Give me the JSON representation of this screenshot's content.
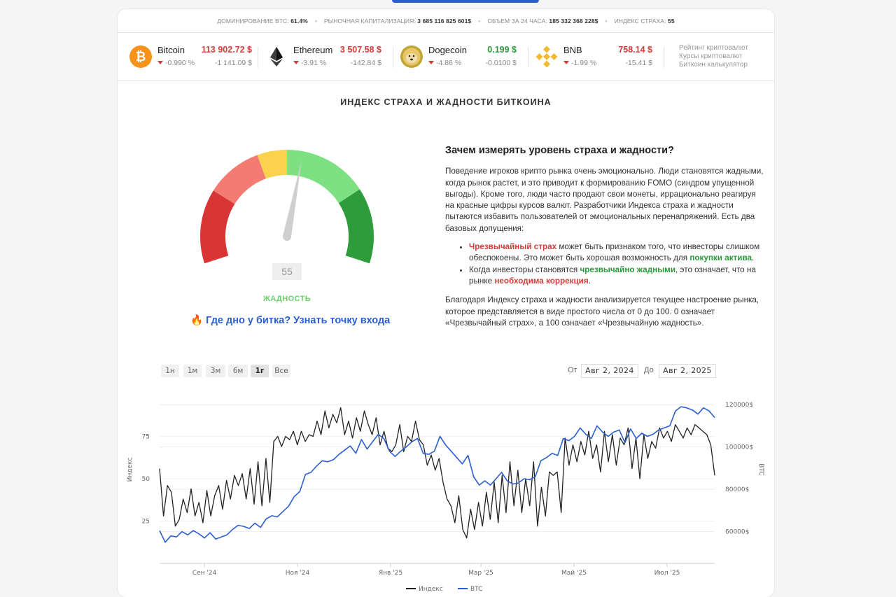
{
  "stats": [
    {
      "label": "ДОМИНИРОВАНИЕ BTC:",
      "value": "61.4%"
    },
    {
      "label": "РЫНОЧНАЯ КАПИТАЛИЗАЦИЯ:",
      "value": "3 685 116 825 601$"
    },
    {
      "label": "ОБЪЕМ ЗА 24 ЧАСА:",
      "value": "185 332 368 228$"
    },
    {
      "label": "ИНДЕКС СТРАХА:",
      "value": "55"
    }
  ],
  "coins": [
    {
      "name": "Bitcoin",
      "price": "113 902.72 $",
      "change_pct": "-0.990 %",
      "change_abs": "-1 141.09 $",
      "price_color": "#d23d3a",
      "icon": "bitcoin-icon"
    },
    {
      "name": "Ethereum",
      "price": "3 507.58 $",
      "change_pct": "-3.91 %",
      "change_abs": "-142.84 $",
      "price_color": "#d23d3a",
      "icon": "ethereum-icon"
    },
    {
      "name": "Dogecoin",
      "price": "0.199 $",
      "change_pct": "-4.86 %",
      "change_abs": "-0.0100 $",
      "price_color": "#2a9a3a",
      "icon": "dogecoin-icon"
    },
    {
      "name": "BNB",
      "price": "758.14 $",
      "change_pct": "-1.99 %",
      "change_abs": "-15.41 $",
      "price_color": "#d23d3a",
      "icon": "bnb-icon"
    }
  ],
  "side_links": [
    "Рейтинг криптовалют",
    "Курсы криптовалют",
    "Биткоин калькулятор"
  ],
  "section_title": "ИНДЕКС СТРАХА И ЖАДНОСТИ БИТКОИНА",
  "gauge": {
    "value": "55",
    "label": "ЖАДНОСТЬ",
    "level": 55
  },
  "cta": {
    "icon": "🔥",
    "text": "Где дно у битка? Узнать точку входа"
  },
  "article": {
    "heading": "Зачем измерять уровень страха и жадности?",
    "p1": "Поведение игроков крипто рынка очень эмоционально. Люди становятся жадными, когда рынок растет, и это приводит к формированию FOMO (синдром упущенной выгоды). Кроме того, люди часто продают свои монеты, иррационально реагируя на красные цифры курсов валют. Разработчики Индекса страха и жадности пытаются избавить пользователей от эмоциональных перенапряжений. Есть два базовых допущения:",
    "b1_kw": "Чрезвычайный страх",
    "b1_mid": " может быть признаком того, что инвесторы слишком обеспокоены. Это может быть хорошая возможность для ",
    "b1_kw2": "покупки актива",
    "b1_end": ".",
    "b2_start": "Когда инвесторы становятся ",
    "b2_kw": "чрезвычайно жадными",
    "b2_mid": ", это означает, что на рынке ",
    "b2_kw2": "необходима коррекция",
    "b2_end": ".",
    "p2": "Благодаря Индексу страха и жадности анализируется текущее настроение рынка, которое представляется в виде простого числа от 0 до 100. 0 означает «Чрезвычайный страх», а 100 означает «Чрезвычайную жадность»."
  },
  "range": {
    "buttons": [
      "1н",
      "1м",
      "3м",
      "6м",
      "1г",
      "Все"
    ],
    "active": "1г",
    "from_label": "От",
    "from": "Авг 2, 2024",
    "to_label": "До",
    "to": "Авг 2, 2025"
  },
  "chart_data": {
    "type": "line",
    "xlabel": "",
    "ylabel_left": "Индекс",
    "ylabel_right": "BTC",
    "x_ticks": [
      "Сен '24",
      "Ноя '24",
      "Янв '25",
      "Мар '25",
      "Май '25",
      "Июл '25"
    ],
    "y_left_ticks": [
      25,
      50,
      75
    ],
    "y_right_ticks": [
      "60000$",
      "80000$",
      "100000$",
      "120000$"
    ],
    "y_left_range": [
      0,
      100
    ],
    "y_right_range": [
      45000,
      125000
    ],
    "series": [
      {
        "name": "Индекс",
        "color": "#222222",
        "values": [
          56,
          28,
          46,
          42,
          22,
          26,
          38,
          30,
          44,
          28,
          36,
          24,
          43,
          28,
          40,
          46,
          32,
          49,
          38,
          52,
          46,
          53,
          38,
          56,
          35,
          60,
          34,
          62,
          36,
          72,
          75,
          69,
          75,
          73,
          78,
          70,
          78,
          72,
          76,
          75,
          84,
          76,
          90,
          80,
          88,
          83,
          92,
          76,
          84,
          74,
          86,
          78,
          90,
          82,
          76,
          86,
          70,
          78,
          68,
          66,
          70,
          82,
          66,
          75,
          72,
          84,
          73,
          70,
          58,
          64,
          55,
          62,
          48,
          38,
          34,
          24,
          40,
          20,
          15,
          32,
          20,
          36,
          22,
          42,
          26,
          48,
          24,
          52,
          30,
          60,
          34,
          55,
          30,
          50,
          34,
          60,
          22,
          45,
          28,
          54,
          52,
          54,
          30,
          74,
          58,
          70,
          60,
          72,
          64,
          78,
          62,
          70,
          54,
          78,
          60,
          76,
          58,
          74,
          70,
          80,
          56,
          74,
          50,
          76,
          62,
          72,
          68,
          80,
          74,
          78,
          72,
          82,
          78,
          74,
          80,
          76,
          82,
          80,
          78,
          76,
          70,
          52
        ]
      },
      {
        "name": "BTC",
        "color": "#2b5fcf",
        "values": [
          60500,
          55000,
          58000,
          57500,
          60000,
          58500,
          60500,
          59000,
          57000,
          59500,
          56500,
          57500,
          58500,
          61000,
          63000,
          62500,
          61500,
          64000,
          62000,
          66000,
          67500,
          67000,
          69500,
          72000,
          76500,
          79000,
          87000,
          88000,
          91000,
          93500,
          93000,
          94000,
          96500,
          98500,
          100500,
          97000,
          103500,
          99000,
          102500,
          106000,
          104000,
          98000,
          95500,
          98000,
          100000,
          102500,
          104000,
          97000,
          96500,
          98000,
          105000,
          101000,
          98000,
          95000,
          92000,
          96000,
          86000,
          82000,
          84000,
          82000,
          85000,
          88000,
          84000,
          82500,
          83000,
          85000,
          84500,
          86000,
          93500,
          95000,
          97000,
          96000,
          104000,
          103000,
          105000,
          109000,
          106000,
          104000,
          110000,
          107000,
          105000,
          107000,
          108000,
          102000,
          108500,
          104000,
          106500,
          105000,
          106000,
          108000,
          109000,
          110000,
          117000,
          119000,
          118500,
          117500,
          115500,
          118500,
          117000,
          113900
        ]
      }
    ]
  }
}
